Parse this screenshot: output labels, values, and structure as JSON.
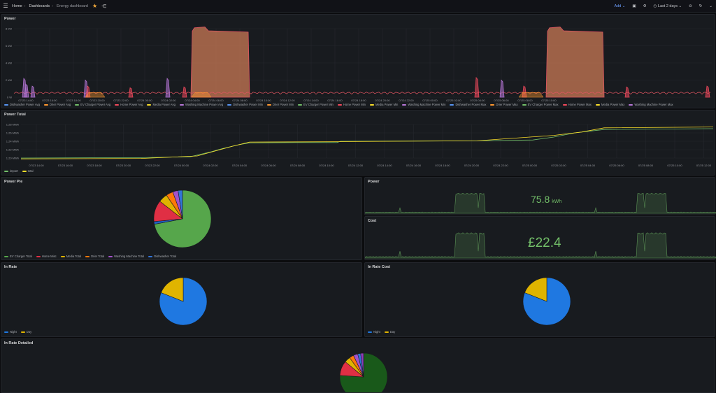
{
  "nav": {
    "breadcrumb_home": "Home",
    "breadcrumb_dashboards": "Dashboards",
    "breadcrumb_current": "Energy dashboard",
    "add_label": "Add",
    "time_range": "Last 2 days"
  },
  "icons": {
    "menu": "menu-icon",
    "star": "star-icon",
    "share": "share-icon",
    "save": "save-icon",
    "settings": "gear-icon",
    "clock": "clock-icon",
    "zoom_out": "zoom-out-icon",
    "refresh": "refresh-icon"
  },
  "colors": {
    "green": "#73bf69",
    "yellow": "#fade2a",
    "red": "#f2495c",
    "blue": "#5794f2",
    "orange": "#ff9830",
    "purple": "#b877d9",
    "dark_green": "#1f60c4"
  },
  "power_panel": {
    "title": "Power",
    "y_ticks": [
      "8 kW",
      "6 kW",
      "4 kW",
      "2 kW",
      "0 W"
    ],
    "x_ticks": [
      "07/23 14:00",
      "07/23 16:00",
      "07/23 18:00",
      "07/23 20:00",
      "07/23 22:00",
      "07/24 00:00",
      "07/24 02:00",
      "07/24 04:00",
      "07/24 06:00",
      "07/24 08:00",
      "07/24 10:00",
      "07/24 12:00",
      "07/24 14:00",
      "07/24 16:00",
      "07/24 18:00",
      "07/24 20:00",
      "07/24 22:00",
      "07/25 00:00",
      "07/25 02:00",
      "07/25 04:00",
      "07/25 06:00",
      "07/25 08:00",
      "07/25 10:00"
    ],
    "legend": [
      {
        "label": "Dishwasher Power Avg",
        "color": "#5794f2"
      },
      {
        "label": "Drier Power Avg",
        "color": "#ff9830"
      },
      {
        "label": "EV Charger Power Avg",
        "color": "#73bf69"
      },
      {
        "label": "Home Power Avg",
        "color": "#f2495c"
      },
      {
        "label": "Media Power Avg",
        "color": "#fade2a"
      },
      {
        "label": "Washing Machine Power Avg",
        "color": "#b877d9"
      },
      {
        "label": "Dishwasher Power Min",
        "color": "#5794f2"
      },
      {
        "label": "Drier Power Min",
        "color": "#ff9830"
      },
      {
        "label": "EV Charger Power Min",
        "color": "#73bf69"
      },
      {
        "label": "Home Power Min",
        "color": "#f2495c"
      },
      {
        "label": "Media Power Min",
        "color": "#fade2a"
      },
      {
        "label": "Washing Machine Power Min",
        "color": "#b877d9"
      },
      {
        "label": "Dishwasher Power Max",
        "color": "#5794f2"
      },
      {
        "label": "Drier Power Max",
        "color": "#ff9830"
      },
      {
        "label": "EV Charger Power Max",
        "color": "#73bf69"
      },
      {
        "label": "Home Power Max",
        "color": "#f2495c"
      },
      {
        "label": "Media Power Max",
        "color": "#fade2a"
      },
      {
        "label": "Washing Machine Power Max",
        "color": "#b877d9"
      }
    ]
  },
  "power_total_panel": {
    "title": "Power Total",
    "y_ticks": [
      "1.28 MWh",
      "1.26 MWh",
      "1.24 MWh",
      "1.22 MWh",
      "1.20 MWh"
    ],
    "x_ticks": [
      "07/23 14:00",
      "07/23 16:00",
      "07/23 18:00",
      "07/23 20:00",
      "07/23 22:00",
      "07/24 00:00",
      "07/24 02:00",
      "07/24 04:00",
      "07/24 06:00",
      "07/24 08:00",
      "07/24 10:00",
      "07/24 12:00",
      "07/24 14:00",
      "07/24 16:00",
      "07/24 18:00",
      "07/24 20:00",
      "07/24 22:00",
      "07/25 00:00",
      "07/25 02:00",
      "07/25 04:00",
      "07/25 06:00",
      "07/25 08:00",
      "07/25 10:00",
      "07/25 12:00"
    ],
    "legend": [
      {
        "label": "import",
        "color": "#73bf69"
      },
      {
        "label": "total",
        "color": "#fade2a"
      }
    ]
  },
  "power_pie_panel": {
    "title": "Power Pie",
    "legend": [
      {
        "label": "EV Charger Total",
        "color": "#56a64b"
      },
      {
        "label": "Home Misc",
        "color": "#e02f44"
      },
      {
        "label": "Media Total",
        "color": "#e0b400"
      },
      {
        "label": "Drier Total",
        "color": "#ff780a"
      },
      {
        "label": "Washing Machine Total",
        "color": "#a352cc"
      },
      {
        "label": "Dishwasher Total",
        "color": "#3274d9"
      }
    ]
  },
  "power_stat_panel": {
    "title": "Power",
    "value": "75.8",
    "unit": "kWh"
  },
  "cost_stat_panel": {
    "title": "Cost",
    "value": "£22.4"
  },
  "in_rate_panel": {
    "title": "In Rate",
    "legend": [
      {
        "label": "Night",
        "color": "#1f78e1"
      },
      {
        "label": "Day",
        "color": "#e0b400"
      }
    ]
  },
  "in_rate_cost_panel": {
    "title": "In Rate Cost",
    "legend": [
      {
        "label": "Night",
        "color": "#1f78e1"
      },
      {
        "label": "Day",
        "color": "#e0b400"
      }
    ]
  },
  "in_rate_detailed_panel": {
    "title": "In Rate Detailed"
  }
}
